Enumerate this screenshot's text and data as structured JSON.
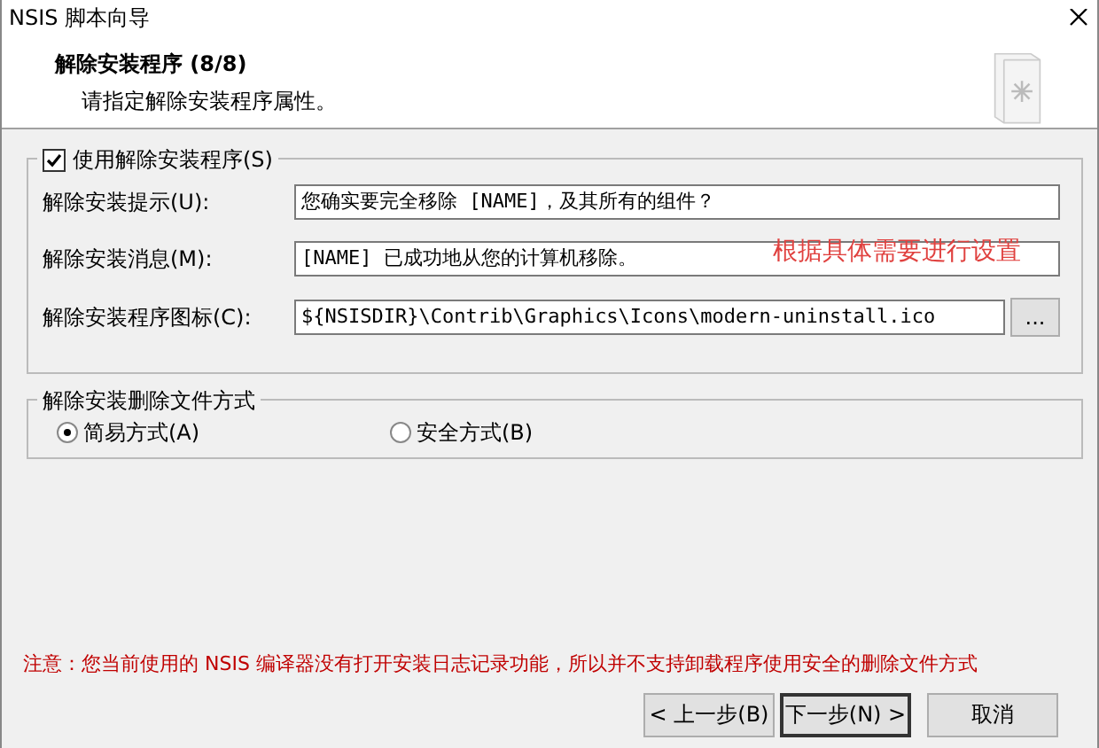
{
  "window": {
    "title": "NSIS 脚本向导"
  },
  "header": {
    "title": "解除安装程序 (8/8)",
    "subtitle": "请指定解除安装程序属性。"
  },
  "uninstaller_group": {
    "label": "使用解除安装程序(S)",
    "checked": true,
    "fields": [
      {
        "label": "解除安装提示(U):",
        "value": "您确实要完全移除 [NAME]，及其所有的组件？"
      },
      {
        "label": "解除安装消息(M):",
        "value": "[NAME] 已成功地从您的计算机移除。"
      },
      {
        "label": "解除安装程序图标(C):",
        "value": "${NSISDIR}\\Contrib\\Graphics\\Icons\\modern-uninstall.ico",
        "browse": "..."
      }
    ],
    "annotation": "根据具体需要进行设置"
  },
  "delete_mode_group": {
    "label": "解除安装删除文件方式",
    "options": [
      {
        "label": "简易方式(A)",
        "selected": true
      },
      {
        "label": "安全方式(B)",
        "selected": false
      }
    ]
  },
  "note": "注意：您当前使用的 NSIS 编译器没有打开安装日志记录功能，所以并不支持卸载程序使用安全的删除文件方式",
  "buttons": [
    {
      "label": "< 上一步(B)",
      "default": false
    },
    {
      "label": "下一步(N) >",
      "default": true
    },
    {
      "label": "取消",
      "default": false
    }
  ]
}
